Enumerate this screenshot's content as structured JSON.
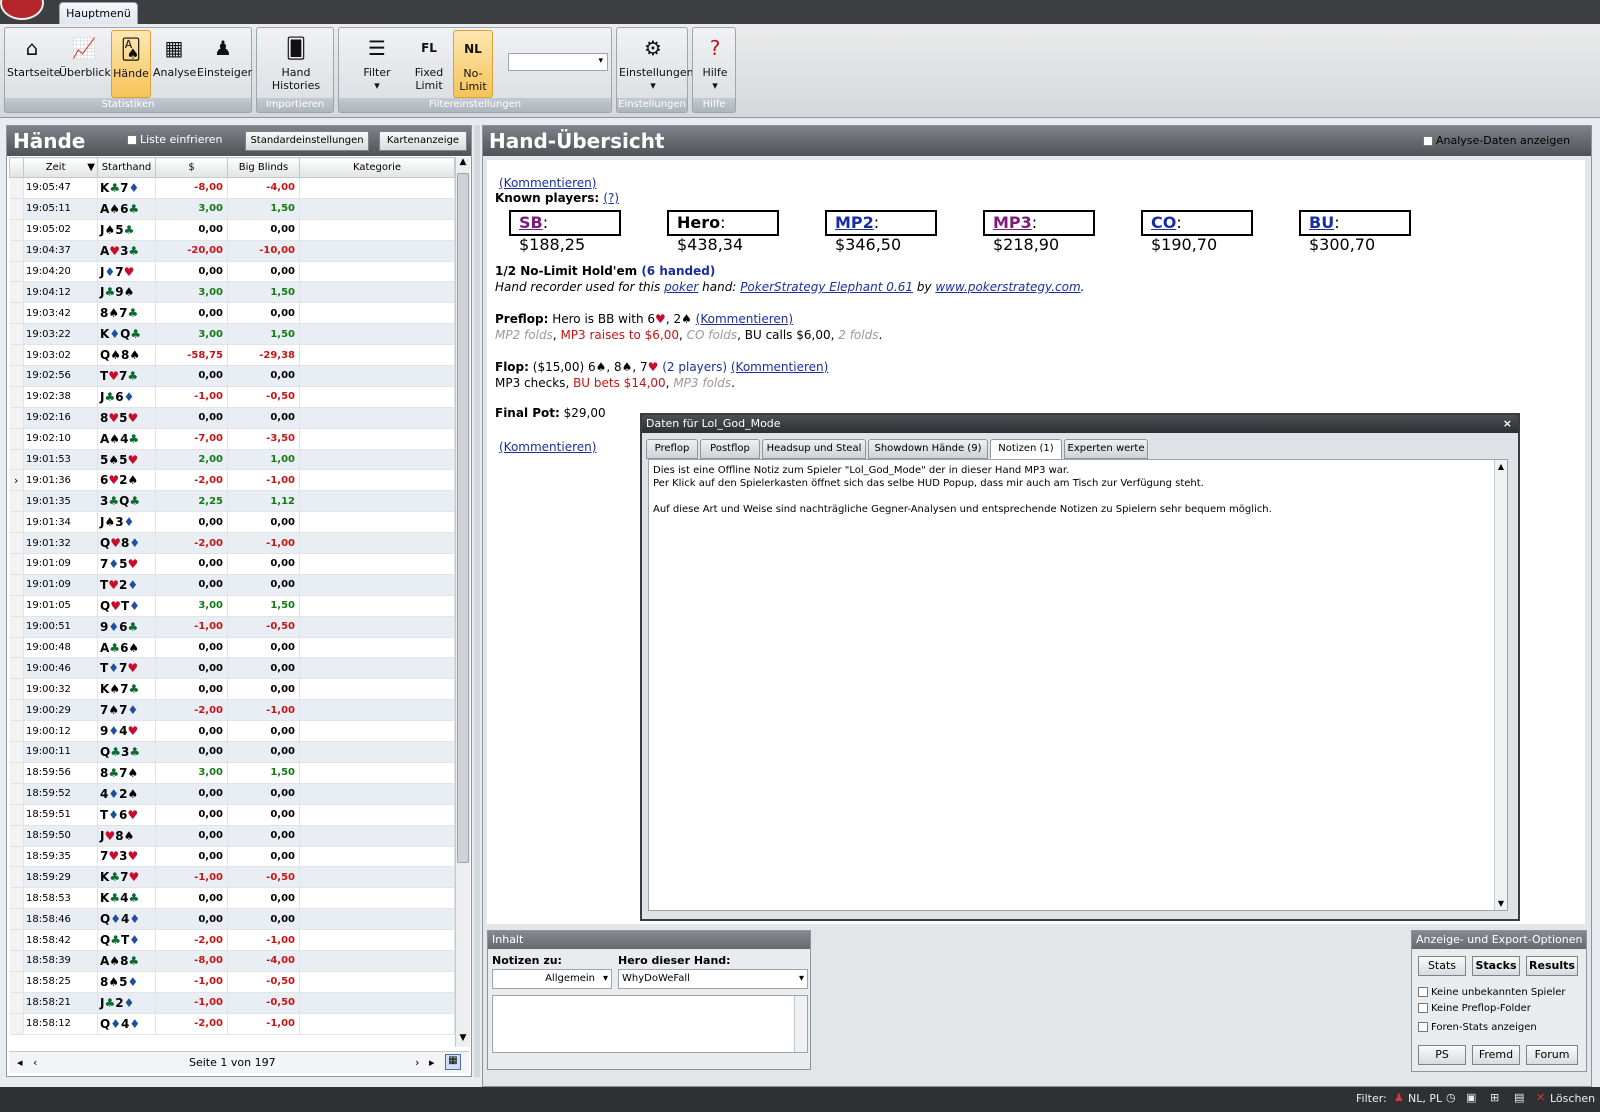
{
  "app": {
    "tab_main": "Hauptmenü"
  },
  "ribbon": {
    "groups": {
      "stats": "Statistiken",
      "import": "Importieren",
      "filter": "Filtereinstellungen",
      "settings": "Einstellungen",
      "help": "Hilfe"
    },
    "buttons": {
      "start": "Startseite",
      "overview": "Überblick",
      "hands": "Hände",
      "analysis": "Analyse",
      "beginner": "Einsteiger",
      "hand_histories": "Hand Histories",
      "filter": "Filter",
      "fixed_limit_1": "Fixed",
      "fixed_limit_2": "Limit",
      "no_limit": "No-Limit",
      "settings": "Einstellungen",
      "help": "Hilfe"
    }
  },
  "hands_panel": {
    "title": "Hände",
    "freeze_label": "Liste einfrieren",
    "defaults_button": "Standardeinstellungen",
    "cards_button": "Kartenanzeige",
    "columns": [
      "Zeit",
      "Starthand",
      "$",
      "Big Blinds",
      "Kategorie"
    ],
    "rows": [
      {
        "time": "19:05:47",
        "c1": "K",
        "s1": "♣",
        "c2": "7",
        "s2": "♦",
        "usd": "-8,00",
        "bb": "-4,00"
      },
      {
        "time": "19:05:11",
        "c1": "A",
        "s1": "♠",
        "c2": "6",
        "s2": "♣",
        "usd": "3,00",
        "bb": "1,50"
      },
      {
        "time": "19:05:02",
        "c1": "J",
        "s1": "♠",
        "c2": "5",
        "s2": "♣",
        "usd": "0,00",
        "bb": "0,00"
      },
      {
        "time": "19:04:37",
        "c1": "A",
        "s1": "♥",
        "c2": "3",
        "s2": "♣",
        "usd": "-20,00",
        "bb": "-10,00"
      },
      {
        "time": "19:04:20",
        "c1": "J",
        "s1": "♦",
        "c2": "7",
        "s2": "♥",
        "usd": "0,00",
        "bb": "0,00"
      },
      {
        "time": "19:04:12",
        "c1": "J",
        "s1": "♣",
        "c2": "9",
        "s2": "♠",
        "usd": "3,00",
        "bb": "1,50"
      },
      {
        "time": "19:03:42",
        "c1": "8",
        "s1": "♠",
        "c2": "7",
        "s2": "♣",
        "usd": "0,00",
        "bb": "0,00"
      },
      {
        "time": "19:03:22",
        "c1": "K",
        "s1": "♦",
        "c2": "Q",
        "s2": "♣",
        "usd": "3,00",
        "bb": "1,50"
      },
      {
        "time": "19:03:02",
        "c1": "Q",
        "s1": "♠",
        "c2": "8",
        "s2": "♠",
        "usd": "-58,75",
        "bb": "-29,38"
      },
      {
        "time": "19:02:56",
        "c1": "T",
        "s1": "♥",
        "c2": "7",
        "s2": "♣",
        "usd": "0,00",
        "bb": "0,00"
      },
      {
        "time": "19:02:38",
        "c1": "J",
        "s1": "♣",
        "c2": "6",
        "s2": "♦",
        "usd": "-1,00",
        "bb": "-0,50"
      },
      {
        "time": "19:02:16",
        "c1": "8",
        "s1": "♥",
        "c2": "5",
        "s2": "♥",
        "usd": "0,00",
        "bb": "0,00"
      },
      {
        "time": "19:02:10",
        "c1": "A",
        "s1": "♠",
        "c2": "4",
        "s2": "♣",
        "usd": "-7,00",
        "bb": "-3,50"
      },
      {
        "time": "19:01:53",
        "c1": "5",
        "s1": "♠",
        "c2": "5",
        "s2": "♥",
        "usd": "2,00",
        "bb": "1,00"
      },
      {
        "time": "19:01:36",
        "c1": "6",
        "s1": "♥",
        "c2": "2",
        "s2": "♠",
        "usd": "-2,00",
        "bb": "-1,00",
        "selected": true
      },
      {
        "time": "19:01:35",
        "c1": "3",
        "s1": "♣",
        "c2": "Q",
        "s2": "♣",
        "usd": "2,25",
        "bb": "1,12"
      },
      {
        "time": "19:01:34",
        "c1": "J",
        "s1": "♠",
        "c2": "3",
        "s2": "♦",
        "usd": "0,00",
        "bb": "0,00"
      },
      {
        "time": "19:01:32",
        "c1": "Q",
        "s1": "♥",
        "c2": "8",
        "s2": "♦",
        "usd": "-2,00",
        "bb": "-1,00"
      },
      {
        "time": "19:01:09",
        "c1": "7",
        "s1": "♦",
        "c2": "5",
        "s2": "♥",
        "usd": "0,00",
        "bb": "0,00"
      },
      {
        "time": "19:01:09",
        "c1": "T",
        "s1": "♥",
        "c2": "2",
        "s2": "♦",
        "usd": "0,00",
        "bb": "0,00"
      },
      {
        "time": "19:01:05",
        "c1": "Q",
        "s1": "♥",
        "c2": "T",
        "s2": "♦",
        "usd": "3,00",
        "bb": "1,50"
      },
      {
        "time": "19:00:51",
        "c1": "9",
        "s1": "♦",
        "c2": "6",
        "s2": "♣",
        "usd": "-1,00",
        "bb": "-0,50"
      },
      {
        "time": "19:00:48",
        "c1": "A",
        "s1": "♣",
        "c2": "6",
        "s2": "♠",
        "usd": "0,00",
        "bb": "0,00"
      },
      {
        "time": "19:00:46",
        "c1": "T",
        "s1": "♦",
        "c2": "7",
        "s2": "♥",
        "usd": "0,00",
        "bb": "0,00"
      },
      {
        "time": "19:00:32",
        "c1": "K",
        "s1": "♠",
        "c2": "7",
        "s2": "♣",
        "usd": "0,00",
        "bb": "0,00"
      },
      {
        "time": "19:00:29",
        "c1": "7",
        "s1": "♠",
        "c2": "7",
        "s2": "♦",
        "usd": "-2,00",
        "bb": "-1,00"
      },
      {
        "time": "19:00:12",
        "c1": "9",
        "s1": "♦",
        "c2": "4",
        "s2": "♥",
        "usd": "0,00",
        "bb": "0,00"
      },
      {
        "time": "19:00:11",
        "c1": "Q",
        "s1": "♣",
        "c2": "3",
        "s2": "♣",
        "usd": "0,00",
        "bb": "0,00"
      },
      {
        "time": "18:59:56",
        "c1": "8",
        "s1": "♣",
        "c2": "7",
        "s2": "♠",
        "usd": "3,00",
        "bb": "1,50"
      },
      {
        "time": "18:59:52",
        "c1": "4",
        "s1": "♦",
        "c2": "2",
        "s2": "♠",
        "usd": "0,00",
        "bb": "0,00"
      },
      {
        "time": "18:59:51",
        "c1": "T",
        "s1": "♦",
        "c2": "6",
        "s2": "♥",
        "usd": "0,00",
        "bb": "0,00"
      },
      {
        "time": "18:59:50",
        "c1": "J",
        "s1": "♥",
        "c2": "8",
        "s2": "♠",
        "usd": "0,00",
        "bb": "0,00"
      },
      {
        "time": "18:59:35",
        "c1": "7",
        "s1": "♥",
        "c2": "3",
        "s2": "♥",
        "usd": "0,00",
        "bb": "0,00"
      },
      {
        "time": "18:59:29",
        "c1": "K",
        "s1": "♣",
        "c2": "7",
        "s2": "♥",
        "usd": "-1,00",
        "bb": "-0,50"
      },
      {
        "time": "18:58:53",
        "c1": "K",
        "s1": "♣",
        "c2": "4",
        "s2": "♣",
        "usd": "0,00",
        "bb": "0,00"
      },
      {
        "time": "18:58:46",
        "c1": "Q",
        "s1": "♦",
        "c2": "4",
        "s2": "♦",
        "usd": "0,00",
        "bb": "0,00"
      },
      {
        "time": "18:58:42",
        "c1": "Q",
        "s1": "♣",
        "c2": "T",
        "s2": "♦",
        "usd": "-2,00",
        "bb": "-1,00"
      },
      {
        "time": "18:58:39",
        "c1": "A",
        "s1": "♠",
        "c2": "8",
        "s2": "♣",
        "usd": "-8,00",
        "bb": "-4,00"
      },
      {
        "time": "18:58:25",
        "c1": "8",
        "s1": "♠",
        "c2": "5",
        "s2": "♦",
        "usd": "-1,00",
        "bb": "-0,50"
      },
      {
        "time": "18:58:21",
        "c1": "J",
        "s1": "♣",
        "c2": "2",
        "s2": "♦",
        "usd": "-1,00",
        "bb": "-0,50"
      },
      {
        "time": "18:58:12",
        "c1": "Q",
        "s1": "♦",
        "c2": "4",
        "s2": "♦",
        "usd": "-2,00",
        "bb": "-1,00"
      }
    ],
    "pager": "Seite 1 von 197"
  },
  "hand_view": {
    "title": "Hand-Übersicht",
    "analysis_toggle": "Analyse-Daten anzeigen",
    "comment_link": "(Kommentieren)",
    "known_players": "Known players:",
    "help_link": "(?)",
    "players": [
      {
        "pos": "SB",
        "stack": ": $188,25",
        "color": "#7a1d7a",
        "link": true
      },
      {
        "pos": "Hero",
        "stack": ": $438,34",
        "color": "#000",
        "link": false
      },
      {
        "pos": "MP2",
        "stack": ": $346,50",
        "color": "#1a2f9e",
        "link": true
      },
      {
        "pos": "MP3",
        "stack": ": $218,90",
        "color": "#7a1d7a",
        "link": true
      },
      {
        "pos": "CO",
        "stack": ": $190,70",
        "color": "#1a2f9e",
        "link": true
      },
      {
        "pos": "BU",
        "stack": ": $300,70",
        "color": "#1a2f9e",
        "link": true
      }
    ],
    "game_title": "1/2 No-Limit Hold'em",
    "game_handed": "(6 handed)",
    "recorder_prefix": "Hand recorder used for this",
    "recorder_poker": "poker",
    "recorder_mid": "hand:",
    "recorder_tool": "PokerStrategy Elephant 0.61",
    "recorder_by": "by",
    "recorder_site": "www.pokerstrategy.com",
    "recorder_dot": ".",
    "preflop_label": "Preflop:",
    "preflop_text": "Hero is BB with 6",
    "preflop_comma": ", 2",
    "preflop_a1": "MP2 folds",
    "preflop_a2": "MP3 raises to $6,00",
    "preflop_a3": "CO folds",
    "preflop_a4": "BU calls $6,00",
    "preflop_a5": "2 folds",
    "flop_label": "Flop:",
    "flop_pot": "($15,00) 6",
    "flop_c2": ", 8",
    "flop_c3": ", 7",
    "flop_players": "(2 players)",
    "flop_a1": "MP3 checks",
    "flop_a2": "BU bets $14,00",
    "flop_a3": "MP3 folds",
    "final_pot_label": "Final Pot:",
    "final_pot_value": "$29,00"
  },
  "popup": {
    "title": "Daten für Lol_God_Mode",
    "close": "×",
    "tabs": [
      "Preflop",
      "Postflop",
      "Headsup und Steal",
      "Showdown Hände (9)",
      "Notizen (1)",
      "Experten werte"
    ],
    "note_line1": "Dies ist eine Offline Notiz zum Spieler \"Lol_God_Mode\" der in dieser Hand MP3 war.",
    "note_line2": "Per Klick auf den Spielerkasten öffnet sich das selbe HUD Popup, dass mir auch am Tisch zur Verfügung steht.",
    "note_line3": "Auf diese Art und Weise sind nachträgliche Gegner-Analysen und entsprechende Notizen zu Spielern sehr bequem möglich."
  },
  "content_box": {
    "title": "Inhalt",
    "notes_for": "Notizen zu:",
    "notes_value": "Allgemein",
    "hero_label": "Hero dieser Hand:",
    "hero_value": "WhyDoWeFall"
  },
  "export_box": {
    "title": "Anzeige- und Export-Optionen",
    "btn_stats": "Stats",
    "btn_stacks": "Stacks",
    "btn_results": "Results",
    "opt1": "Keine unbekannten Spieler",
    "opt2": "Keine Preflop-Folder",
    "opt3": "Foren-Stats anzeigen",
    "btn_ps": "PS",
    "btn_fremd": "Fremd",
    "btn_forum": "Forum"
  },
  "status": {
    "filter_label": "Filter:",
    "filter_value": "NL, PL",
    "clear": "Löschen"
  },
  "colors": {
    "accent": "#f6c35a",
    "negative": "#c81414",
    "positive": "#157a15",
    "link": "#1a2f9e"
  }
}
